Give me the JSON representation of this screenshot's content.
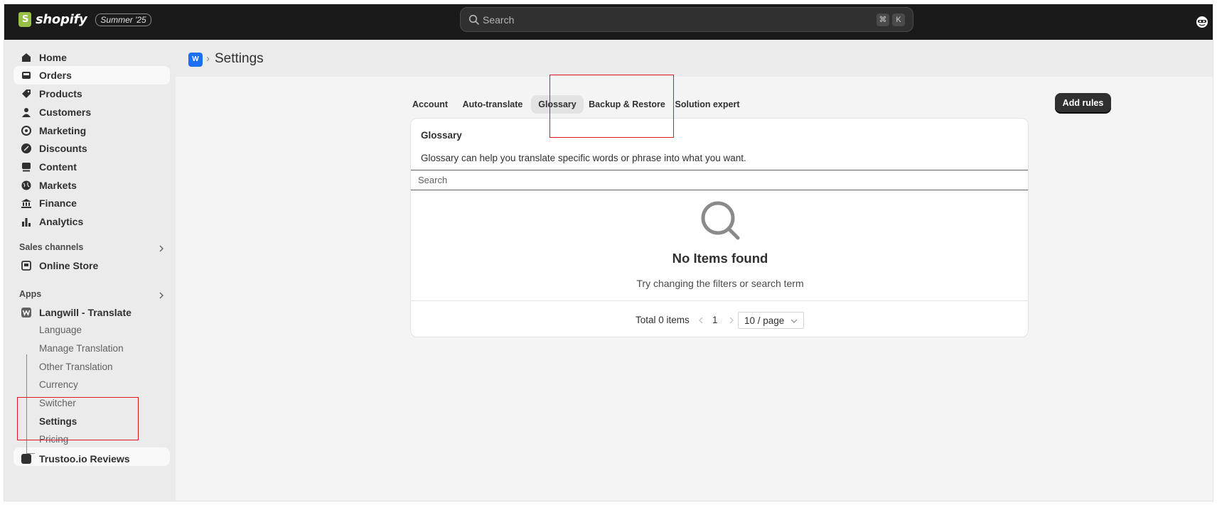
{
  "topbar": {
    "brand": "shopify",
    "edition_badge": "Summer '25",
    "search_placeholder": "Search",
    "shortcut_keys": [
      "⌘",
      "K"
    ]
  },
  "sidebar": {
    "items": [
      {
        "label": "Home",
        "icon": "home-icon"
      },
      {
        "label": "Orders",
        "icon": "orders-icon"
      },
      {
        "label": "Products",
        "icon": "tag-icon"
      },
      {
        "label": "Customers",
        "icon": "person-icon"
      },
      {
        "label": "Marketing",
        "icon": "target-icon"
      },
      {
        "label": "Discounts",
        "icon": "discount-icon"
      },
      {
        "label": "Content",
        "icon": "content-icon"
      },
      {
        "label": "Markets",
        "icon": "globe-icon"
      },
      {
        "label": "Finance",
        "icon": "bank-icon"
      },
      {
        "label": "Analytics",
        "icon": "bar-chart-icon"
      }
    ],
    "sales_channels_title": "Sales channels",
    "online_store": "Online Store",
    "apps_title": "Apps",
    "app_name": "Langwill - Translate",
    "app_subitems": [
      "Language",
      "Manage Translation",
      "Other Translation",
      "Currency",
      "Switcher",
      "Settings",
      "Pricing"
    ],
    "next_app": "Trustoo.io Reviews"
  },
  "page": {
    "title": "Settings",
    "app_icon_text": "W"
  },
  "tabs": [
    "Account",
    "Auto-translate",
    "Glossary",
    "Backup & Restore",
    "Solution expert"
  ],
  "selected_tab": "Glossary",
  "add_rules_button": "Add rules",
  "card": {
    "title": "Glossary",
    "description": "Glossary can help you translate specific words or phrase into what you want.",
    "search_placeholder": "Search",
    "empty_title": "No Items found",
    "empty_subtitle": "Try changing the filters or search term"
  },
  "pagination": {
    "total": "Total 0 items",
    "current_page": "1",
    "page_size": "10 / page"
  },
  "colors": {
    "topbar": "#1a1a1a",
    "sidebar": "#ebebeb",
    "accent_app": "#1c6ef2",
    "primary_button": "#303030",
    "annotation": "#e0191e"
  }
}
